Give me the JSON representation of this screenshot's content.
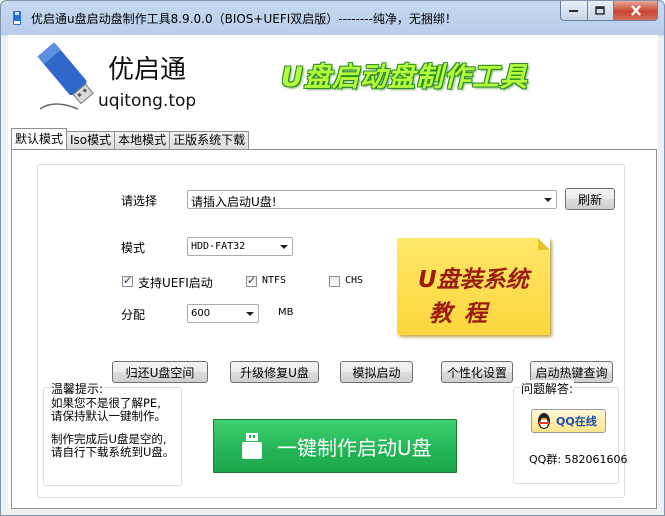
{
  "window": {
    "title": "优启通u盘启动盘制作工具8.9.0.0（BIOS+UEFI双启版）--------纯净，无捆绑！"
  },
  "header": {
    "brand_name": "优启通",
    "brand_url": "uqitong.top",
    "slogan": "U盘启动盘制作工具"
  },
  "tabs": [
    {
      "label": "默认模式",
      "active": true
    },
    {
      "label": "Iso模式",
      "active": false
    },
    {
      "label": "本地模式",
      "active": false
    },
    {
      "label": "正版系统下载",
      "active": false
    }
  ],
  "main": {
    "select_label": "请选择",
    "device_combo_value": "请插入启动U盘!",
    "refresh_label": "刷新",
    "mode_label": "模式",
    "mode_value": "HDD-FAT32",
    "uefi_label": "支持UEFI启动",
    "uefi_checked": true,
    "ntfs_label": "NTFS",
    "ntfs_checked": true,
    "chs_label": "CHS",
    "chs_checked": false,
    "alloc_label": "分配",
    "alloc_value": "600",
    "alloc_unit": "MB",
    "tutorial_line1": "U盘装系统",
    "tutorial_line2": "教程"
  },
  "actions": {
    "restore": "归还U盘空间",
    "upgrade": "升级修复U盘",
    "simulate": "模拟启动",
    "personalize": "个性化设置",
    "hotkey": "启动热键查询"
  },
  "tips": {
    "title": "温馨提示:",
    "line1": "如果您不是很了解PE,",
    "line2": "请保持默认一键制作。",
    "line3": "制作完成后U盘是空的,",
    "line4": "请自行下载系统到U盘。"
  },
  "onekey_label": "一键制作启动U盘",
  "qa": {
    "title": "问题解答:",
    "qq_button": "QQ在线",
    "qq_group": "QQ群: 582061606"
  },
  "colors": {
    "onekey_bg": "#22b455",
    "slogan": "#b6ff3c",
    "tutorial_bg": "#fcd63c",
    "tutorial_text": "#9a1c0c"
  }
}
